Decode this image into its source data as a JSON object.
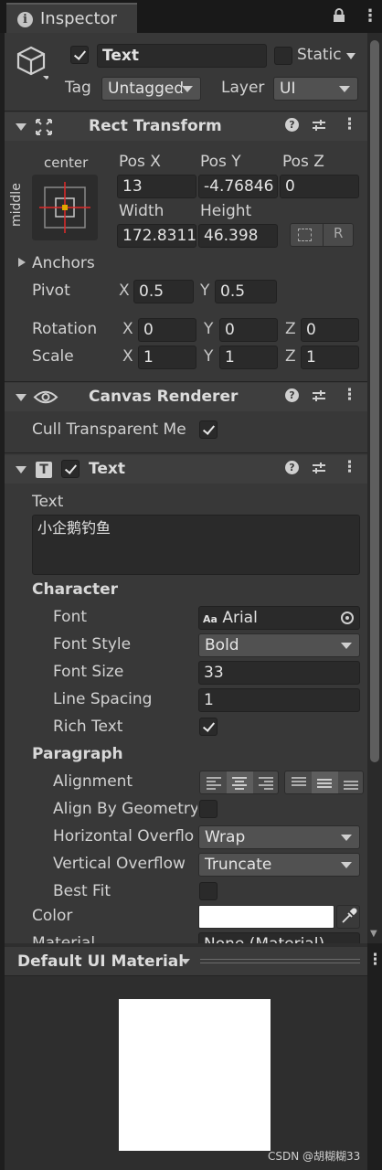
{
  "window": {
    "tab_title": "Inspector"
  },
  "gameobject": {
    "active": true,
    "name": "Text",
    "static_label": "Static",
    "tag_label": "Tag",
    "tag_value": "Untagged",
    "layer_label": "Layer",
    "layer_value": "UI"
  },
  "rect_transform": {
    "title": "Rect Transform",
    "anchor_h": "center",
    "anchor_v": "middle",
    "pos_x_label": "Pos X",
    "pos_y_label": "Pos Y",
    "pos_z_label": "Pos Z",
    "pos_x": "13",
    "pos_y": "-4.76846",
    "pos_z": "0",
    "width_label": "Width",
    "height_label": "Height",
    "width": "172.8311",
    "height": "46.398",
    "raw_button": "R",
    "anchors_label": "Anchors",
    "pivot_label": "Pivot",
    "pivot_x": "0.5",
    "pivot_y": "0.5",
    "rotation_label": "Rotation",
    "rotation_x": "0",
    "rotation_y": "0",
    "rotation_z": "0",
    "scale_label": "Scale",
    "scale_x": "1",
    "scale_y": "1",
    "scale_z": "1",
    "axis_x": "X",
    "axis_y": "Y",
    "axis_z": "Z"
  },
  "canvas_renderer": {
    "title": "Canvas Renderer",
    "cull_label": "Cull Transparent Me",
    "cull_checked": true
  },
  "text_component": {
    "title": "Text",
    "enabled": true,
    "text_label": "Text",
    "text_value": "小企鹅钓鱼",
    "character_label": "Character",
    "font_label": "Font",
    "font_value": "Arial",
    "font_badge": "Aa",
    "font_style_label": "Font Style",
    "font_style_value": "Bold",
    "font_size_label": "Font Size",
    "font_size_value": "33",
    "line_spacing_label": "Line Spacing",
    "line_spacing_value": "1",
    "rich_text_label": "Rich Text",
    "rich_text_checked": true,
    "paragraph_label": "Paragraph",
    "alignment_label": "Alignment",
    "align_by_geometry_label": "Align By Geometry",
    "align_by_geometry_checked": false,
    "h_overflow_label": "Horizontal Overflo",
    "h_overflow_value": "Wrap",
    "v_overflow_label": "Vertical Overflow",
    "v_overflow_value": "Truncate",
    "best_fit_label": "Best Fit",
    "best_fit_checked": false,
    "color_label": "Color",
    "color_value": "#ffffff",
    "material_label": "Material",
    "material_value": "None (Material)"
  },
  "preview": {
    "title": "Default UI Material"
  },
  "watermark": "CSDN @胡糊糊33",
  "colors": {
    "panel_bg": "#383838",
    "field_bg": "#2a2a2a",
    "header_bg": "#3e3e3e",
    "anchor_red": "#e02a2a",
    "anchor_yellow": "#e0a800"
  }
}
